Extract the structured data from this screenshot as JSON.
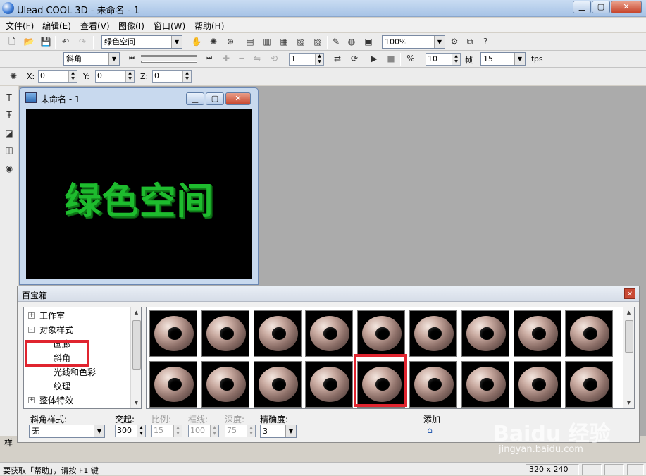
{
  "window": {
    "title": "Ulead COOL 3D - 未命名 - 1"
  },
  "menu": [
    "文件(F)",
    "编辑(E)",
    "查看(V)",
    "图像(I)",
    "窗口(W)",
    "帮助(H)"
  ],
  "toolbar1": {
    "object_combo": "绿色空间",
    "zoom_combo": "100%"
  },
  "toolbar2": {
    "attribute_combo": "斜角",
    "frame_value": "1",
    "fps_frames": "10",
    "frame_label": "帧",
    "fps_value": "15",
    "fps_label": "fps"
  },
  "toolbar3": {
    "x_label": "X:",
    "x_value": "0",
    "y_label": "Y:",
    "y_value": "0",
    "z_label": "Z:",
    "z_value": "0"
  },
  "doc": {
    "title": "未命名 - 1",
    "canvas_text": "绿色空间",
    "canvas_text_color": "#1ebc2e",
    "background": "#000000"
  },
  "palette": {
    "title": "百宝箱",
    "tree": [
      {
        "label": "工作室",
        "toggle": "+"
      },
      {
        "label": "对象样式",
        "toggle": "-"
      },
      {
        "label": "画廊",
        "toggle": ""
      },
      {
        "label": "斜角",
        "toggle": ""
      },
      {
        "label": "光线和色彩",
        "toggle": ""
      },
      {
        "label": "纹理",
        "toggle": ""
      },
      {
        "label": "整体特效",
        "toggle": "+"
      }
    ],
    "controls": {
      "bevel_style_label": "斜角样式:",
      "bevel_style_value": "无",
      "extrude_label": "突起:",
      "extrude_value": "300",
      "ratio_label": "比例:",
      "ratio_value": "15",
      "border_label": "框线:",
      "border_value": "100",
      "depth_label": "深度:",
      "depth_value": "75",
      "precision_label": "精确度:",
      "precision_value": "3",
      "add_label": "添加"
    }
  },
  "left_panel_stub": "样",
  "status": {
    "help_text": "要获取「帮助」，请按 F1 键",
    "size": "320 x 240"
  },
  "watermark": {
    "logo": "Baidu 经验",
    "url": "jingyan.baidu.com"
  },
  "colors": {
    "highlight": "#e0242f",
    "workspace": "#ababab",
    "titlebar": "#b8cfea"
  }
}
